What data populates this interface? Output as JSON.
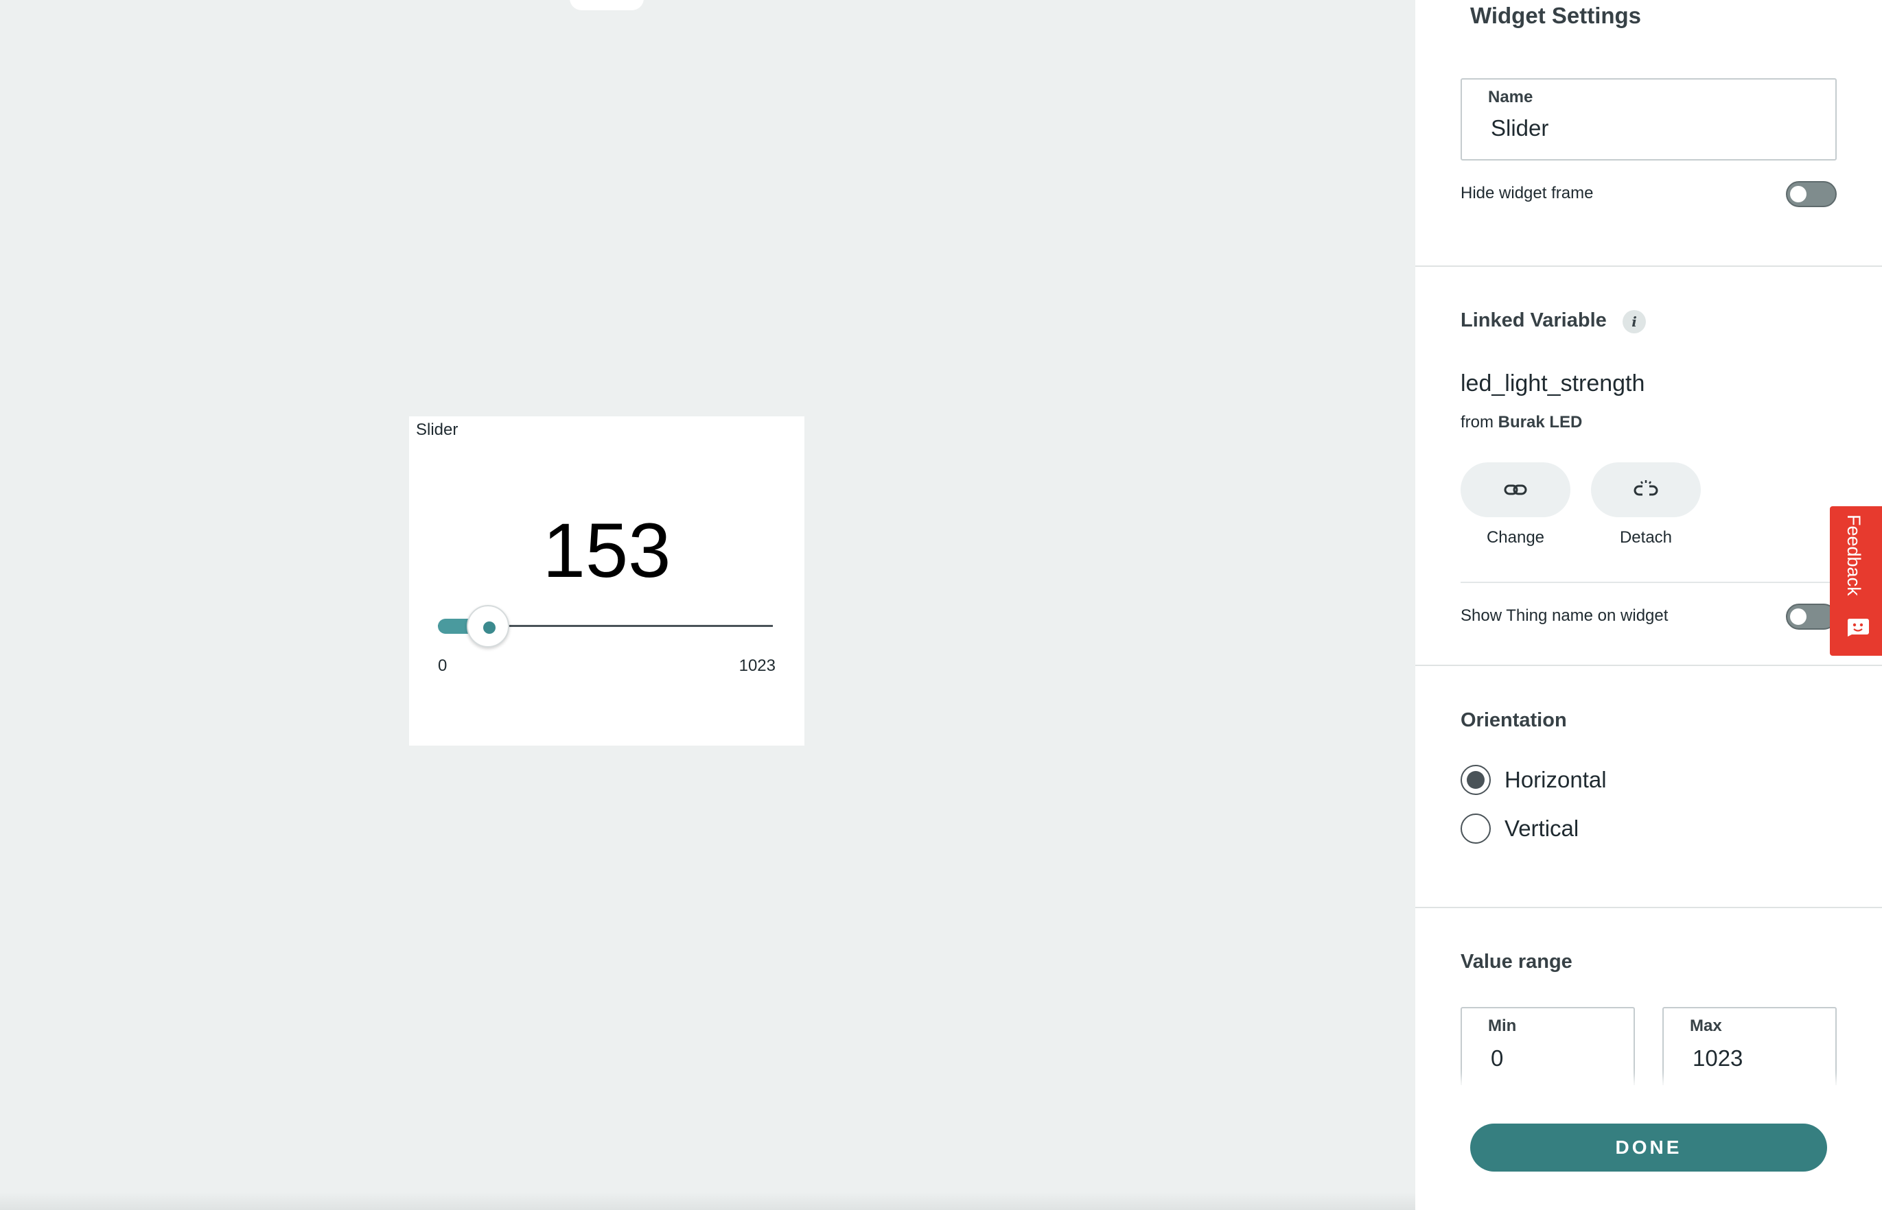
{
  "widget": {
    "title": "Slider",
    "value": "153",
    "min_label": "0",
    "max_label": "1023",
    "fill_fraction": 0.1496
  },
  "settings": {
    "title": "Widget Settings",
    "name_field": {
      "label": "Name",
      "value": "Slider"
    },
    "hide_frame": {
      "label": "Hide widget frame",
      "on": false
    },
    "linked_variable": {
      "section_title": "Linked Variable",
      "info_icon": "i",
      "variable_name": "led_light_strength",
      "from_prefix": "from",
      "thing_name": "Burak LED",
      "change_label": "Change",
      "detach_label": "Detach",
      "show_thing_name": {
        "label": "Show Thing name on widget",
        "on": false
      }
    },
    "orientation": {
      "section_title": "Orientation",
      "options": [
        {
          "label": "Horizontal",
          "selected": true
        },
        {
          "label": "Vertical",
          "selected": false
        }
      ]
    },
    "value_range": {
      "section_title": "Value range",
      "min": {
        "label": "Min",
        "value": "0"
      },
      "max": {
        "label": "Max",
        "value": "1023"
      }
    },
    "done_label": "DONE"
  },
  "feedback": {
    "label": "Feedback"
  },
  "icons": {
    "change": "link-icon",
    "detach": "unlink-icon",
    "feedback": "feedback-face-icon",
    "info": "info-icon"
  },
  "colors": {
    "accent": "#367f80",
    "slider_fill": "#4a9a9e",
    "feedback": "#e73a2e",
    "canvas_bg": "#edf0f0"
  }
}
